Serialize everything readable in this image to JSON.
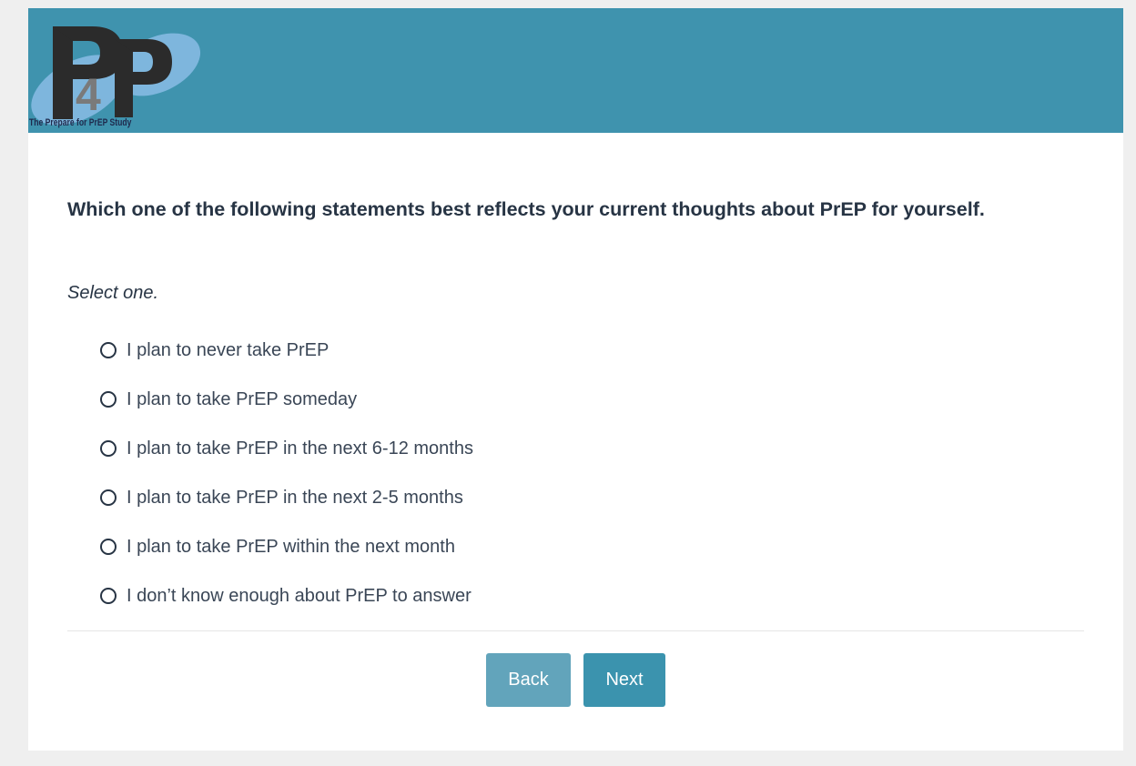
{
  "header": {
    "logo_text": "P4P",
    "logo_caption": "The Prepare for PrEP Study"
  },
  "survey": {
    "question": "Which one of the following statements best reflects your current thoughts about PrEP for yourself.",
    "instruction": "Select one.",
    "options": [
      {
        "label": "I plan to never take PrEP",
        "selected": false
      },
      {
        "label": "I plan to take PrEP someday",
        "selected": false
      },
      {
        "label": "I plan to take PrEP in the next 6-12 months",
        "selected": false
      },
      {
        "label": "I plan to take PrEP in the next 2-5 months",
        "selected": false
      },
      {
        "label": "I plan to take PrEP within the next month",
        "selected": false
      },
      {
        "label": "I don’t know enough about PrEP to answer",
        "selected": false
      }
    ]
  },
  "nav": {
    "back_label": "Back",
    "next_label": "Next"
  },
  "colors": {
    "header_bg": "#3f93ae",
    "page_bg": "#efefef",
    "back_button": "#62a4bb",
    "next_button": "#3b93ae",
    "text": "#273444"
  }
}
